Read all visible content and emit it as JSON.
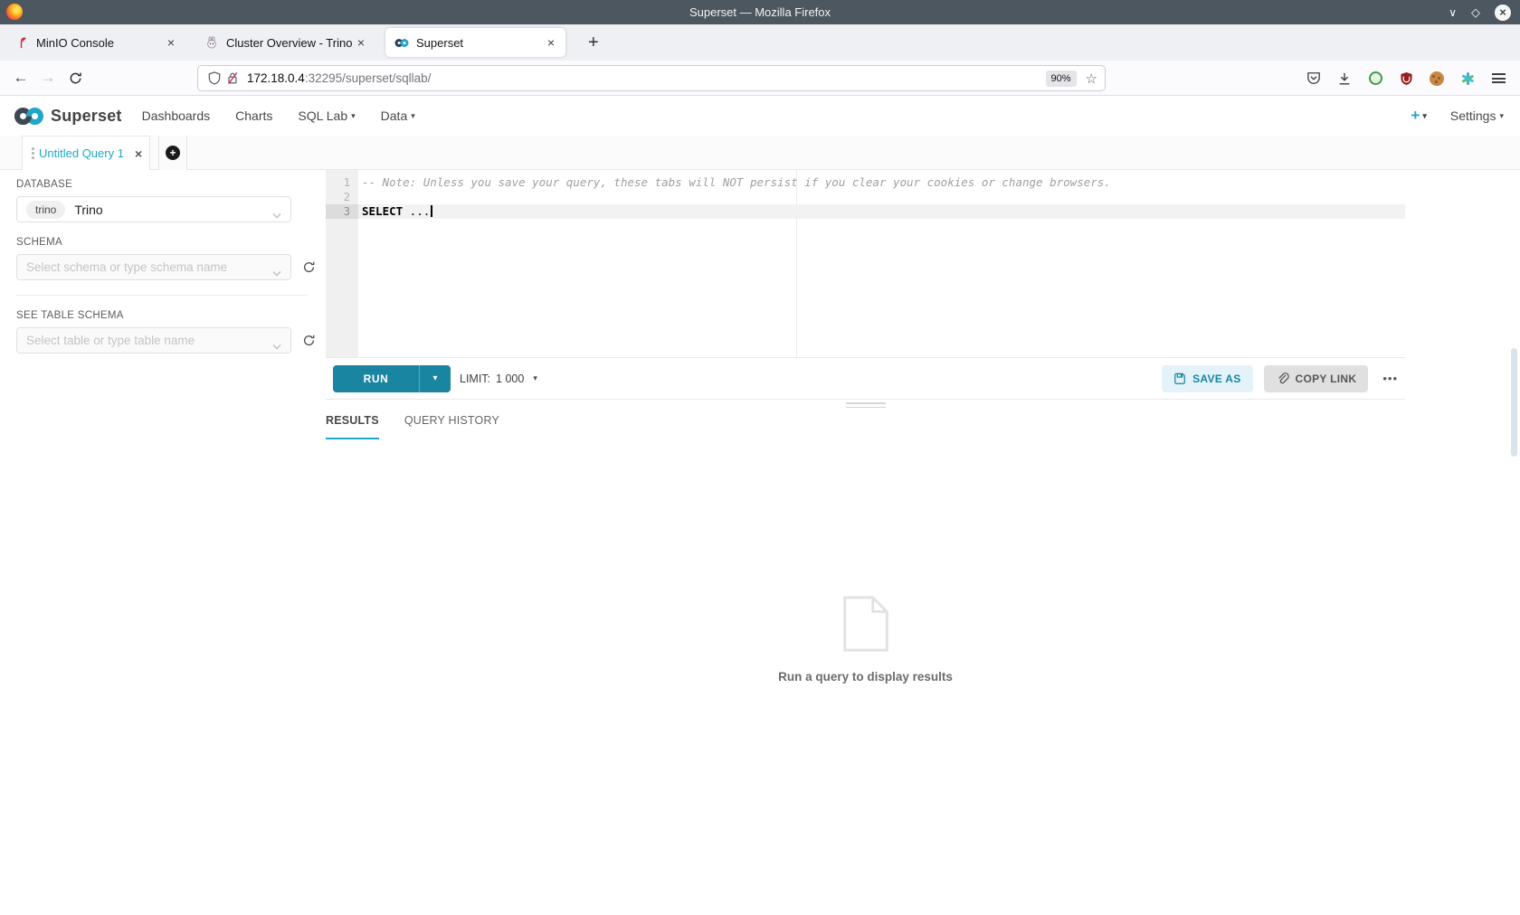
{
  "window": {
    "title": "Superset — Mozilla Firefox",
    "controls": {
      "minimize": "∨",
      "maximize": "◇",
      "close": "×"
    }
  },
  "browser": {
    "tabs": [
      {
        "title": "MinIO Console"
      },
      {
        "title": "Cluster Overview - Trino"
      },
      {
        "title": "Superset"
      }
    ],
    "new_tab": "+",
    "address": {
      "host": "172.18.0.4",
      "rest": ":32295/superset/sqllab/",
      "zoom": "90%",
      "star": "☆"
    }
  },
  "app": {
    "brand": "Superset",
    "nav": [
      {
        "label": "Dashboards"
      },
      {
        "label": "Charts"
      },
      {
        "label": "SQL Lab"
      },
      {
        "label": "Data"
      }
    ],
    "new_shortcut": "+",
    "settings": "Settings"
  },
  "glyphs": {
    "caret": "▾",
    "close": "×"
  },
  "query_tab": {
    "title": "Untitled Query 1",
    "add": "+"
  },
  "sidebar": {
    "database_label": "DATABASE",
    "database_pill": "trino",
    "database_value": "Trino",
    "schema_label": "SCHEMA",
    "schema_placeholder": "Select schema or type schema name",
    "table_label": "SEE TABLE SCHEMA",
    "table_placeholder": "Select table or type table name"
  },
  "sql_editor": {
    "line_numbers": [
      "1",
      "2",
      "3"
    ],
    "comment": "-- Note: Unless you save your query, these tabs will NOT persist if you clear your cookies or change browsers.",
    "keyword": "SELECT",
    "after_keyword": " ..."
  },
  "toolbar": {
    "run": "RUN",
    "limit_label": "LIMIT:",
    "limit_value": "1 000",
    "save_as": "SAVE AS",
    "copy_link": "COPY LINK",
    "more": "•••"
  },
  "south": {
    "tabs": [
      {
        "label": "RESULTS"
      },
      {
        "label": "QUERY HISTORY"
      }
    ],
    "empty_message": "Run a query to display results"
  },
  "colors": {
    "accent": "#1fa8c9",
    "run_button": "#1985a0",
    "titlebar": "#4d575f"
  }
}
